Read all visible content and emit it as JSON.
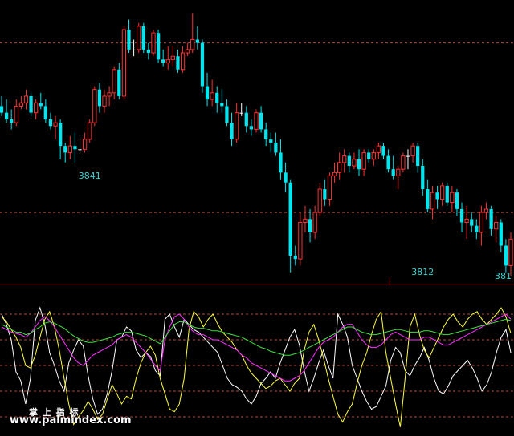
{
  "chart_data": [
    {
      "type": "candlestick",
      "title": "",
      "ylim": [
        3808,
        3890
      ],
      "colors": {
        "up": "#ff3030",
        "down": "#00e5ee",
        "doji": "#ffffff",
        "grid": "#b84a3a"
      },
      "grid_levels": [
        3879,
        3828
      ],
      "annotations": [
        {
          "label": "3841",
          "x": 18,
          "y": 3841
        },
        {
          "label": "3812",
          "x": 86,
          "y": 3812
        },
        {
          "label": "381",
          "x": 157,
          "y": 3811
        }
      ],
      "candles": [
        [
          3860,
          3863,
          3857,
          3858
        ],
        [
          3858,
          3862,
          3855,
          3856
        ],
        [
          3856,
          3859,
          3853,
          3855
        ],
        [
          3855,
          3862,
          3854,
          3860
        ],
        [
          3860,
          3863,
          3859,
          3861
        ],
        [
          3861,
          3865,
          3859,
          3863
        ],
        [
          3863,
          3864,
          3857,
          3858
        ],
        [
          3858,
          3862,
          3856,
          3861
        ],
        [
          3861,
          3864,
          3859,
          3860
        ],
        [
          3860,
          3862,
          3855,
          3856
        ],
        [
          3856,
          3858,
          3853,
          3854
        ],
        [
          3854,
          3857,
          3850,
          3855
        ],
        [
          3855,
          3856,
          3844,
          3848
        ],
        [
          3848,
          3849,
          3843,
          3846
        ],
        [
          3846,
          3851,
          3844,
          3848
        ],
        [
          3848,
          3852,
          3843,
          3847
        ],
        [
          3847,
          3850,
          3845,
          3847
        ],
        [
          3847,
          3852,
          3846,
          3850
        ],
        [
          3850,
          3856,
          3849,
          3855
        ],
        [
          3855,
          3866,
          3854,
          3865
        ],
        [
          3865,
          3867,
          3858,
          3860
        ],
        [
          3860,
          3865,
          3858,
          3863
        ],
        [
          3863,
          3866,
          3860,
          3864
        ],
        [
          3864,
          3872,
          3862,
          3871
        ],
        [
          3871,
          3873,
          3862,
          3863
        ],
        [
          3863,
          3884,
          3862,
          3883
        ],
        [
          3883,
          3886,
          3876,
          3877
        ],
        [
          3877,
          3880,
          3875,
          3877
        ],
        [
          3877,
          3885,
          3876,
          3884
        ],
        [
          3884,
          3885,
          3876,
          3877
        ],
        [
          3877,
          3879,
          3874,
          3876
        ],
        [
          3876,
          3883,
          3875,
          3882
        ],
        [
          3882,
          3883,
          3873,
          3874
        ],
        [
          3874,
          3877,
          3872,
          3873
        ],
        [
          3873,
          3878,
          3871,
          3874
        ],
        [
          3874,
          3878,
          3872,
          3875
        ],
        [
          3875,
          3877,
          3870,
          3871
        ],
        [
          3871,
          3878,
          3870,
          3876
        ],
        [
          3876,
          3879,
          3875,
          3877
        ],
        [
          3877,
          3888,
          3876,
          3880
        ],
        [
          3880,
          3884,
          3877,
          3879
        ],
        [
          3879,
          3880,
          3864,
          3866
        ],
        [
          3866,
          3870,
          3860,
          3862
        ],
        [
          3862,
          3868,
          3860,
          3864
        ],
        [
          3864,
          3866,
          3858,
          3861
        ],
        [
          3861,
          3865,
          3858,
          3860
        ],
        [
          3860,
          3862,
          3854,
          3855
        ],
        [
          3855,
          3858,
          3848,
          3850
        ],
        [
          3850,
          3861,
          3849,
          3858
        ],
        [
          3858,
          3861,
          3857,
          3858
        ],
        [
          3858,
          3860,
          3852,
          3854
        ],
        [
          3854,
          3856,
          3851,
          3853
        ],
        [
          3853,
          3859,
          3852,
          3858
        ],
        [
          3858,
          3860,
          3852,
          3853
        ],
        [
          3853,
          3855,
          3848,
          3850
        ],
        [
          3850,
          3852,
          3846,
          3849
        ],
        [
          3849,
          3852,
          3845,
          3846
        ],
        [
          3846,
          3850,
          3838,
          3840
        ],
        [
          3840,
          3843,
          3834,
          3837
        ],
        [
          3837,
          3838,
          3810,
          3815
        ],
        [
          3815,
          3818,
          3812,
          3814
        ],
        [
          3814,
          3828,
          3812,
          3825
        ],
        [
          3825,
          3830,
          3822,
          3826
        ],
        [
          3826,
          3829,
          3819,
          3822
        ],
        [
          3822,
          3830,
          3820,
          3828
        ],
        [
          3828,
          3837,
          3827,
          3835
        ],
        [
          3835,
          3838,
          3830,
          3832
        ],
        [
          3832,
          3840,
          3830,
          3839
        ],
        [
          3839,
          3843,
          3837,
          3840
        ],
        [
          3840,
          3846,
          3838,
          3843
        ],
        [
          3843,
          3847,
          3840,
          3845
        ],
        [
          3845,
          3846,
          3840,
          3842
        ],
        [
          3842,
          3846,
          3841,
          3844
        ],
        [
          3844,
          3847,
          3839,
          3841
        ],
        [
          3841,
          3847,
          3839,
          3846
        ],
        [
          3846,
          3847,
          3843,
          3844
        ],
        [
          3844,
          3847,
          3842,
          3846
        ],
        [
          3846,
          3849,
          3844,
          3848
        ],
        [
          3848,
          3849,
          3844,
          3845
        ],
        [
          3845,
          3847,
          3840,
          3841
        ],
        [
          3841,
          3845,
          3838,
          3839
        ],
        [
          3839,
          3842,
          3835,
          3841
        ],
        [
          3841,
          3846,
          3840,
          3845
        ],
        [
          3845,
          3847,
          3841,
          3845
        ],
        [
          3845,
          3849,
          3843,
          3848
        ],
        [
          3848,
          3849,
          3840,
          3842
        ],
        [
          3842,
          3844,
          3833,
          3835
        ],
        [
          3835,
          3838,
          3828,
          3829
        ],
        [
          3829,
          3836,
          3826,
          3834
        ],
        [
          3834,
          3836,
          3829,
          3832
        ],
        [
          3832,
          3837,
          3830,
          3836
        ],
        [
          3836,
          3837,
          3830,
          3831
        ],
        [
          3831,
          3836,
          3828,
          3834
        ],
        [
          3834,
          3835,
          3827,
          3829
        ],
        [
          3829,
          3831,
          3822,
          3825
        ],
        [
          3825,
          3830,
          3820,
          3826
        ],
        [
          3826,
          3828,
          3822,
          3824
        ],
        [
          3824,
          3826,
          3820,
          3822
        ],
        [
          3822,
          3830,
          3818,
          3828
        ],
        [
          3828,
          3831,
          3826,
          3829
        ],
        [
          3829,
          3830,
          3821,
          3823
        ],
        [
          3823,
          3827,
          3819,
          3825
        ],
        [
          3825,
          3826,
          3816,
          3818
        ],
        [
          3818,
          3820,
          3810,
          3812
        ],
        [
          3812,
          3822,
          3809,
          3820
        ]
      ]
    },
    {
      "type": "line",
      "title": "",
      "ylim": [
        0,
        100
      ],
      "grid_levels": [
        90,
        70,
        50,
        30,
        10
      ],
      "series": [
        {
          "color": "#ffffff",
          "values": [
            90,
            82,
            70,
            45,
            38,
            20,
            40,
            85,
            95,
            82,
            60,
            50,
            38,
            30,
            52,
            62,
            70,
            65,
            42,
            24,
            12,
            16,
            28,
            46,
            70,
            72,
            80,
            77,
            62,
            56,
            60,
            57,
            46,
            42,
            86,
            90,
            80,
            72,
            86,
            82,
            78,
            76,
            72,
            68,
            64,
            60,
            50,
            40,
            35,
            33,
            30,
            24,
            20,
            26,
            36,
            40,
            45,
            40,
            52,
            62,
            72,
            78,
            66,
            46,
            30,
            40,
            52,
            62,
            50,
            40,
            90,
            82,
            72,
            50,
            40,
            30,
            22,
            16,
            18,
            26,
            34,
            54,
            64,
            60,
            46,
            42,
            50,
            56,
            64,
            54,
            40,
            30,
            28,
            34,
            42,
            46,
            50,
            54,
            48,
            40,
            30,
            35,
            45,
            60,
            72,
            78,
            60
          ]
        },
        {
          "color": "#ffff40",
          "values": [
            88,
            84,
            78,
            72,
            64,
            50,
            48,
            58,
            72,
            86,
            92,
            80,
            62,
            40,
            20,
            4,
            10,
            15,
            22,
            16,
            8,
            12,
            24,
            35,
            28,
            20,
            26,
            24,
            40,
            52,
            60,
            65,
            58,
            40,
            28,
            16,
            14,
            20,
            40,
            78,
            92,
            88,
            80,
            86,
            90,
            82,
            76,
            72,
            68,
            62,
            58,
            50,
            44,
            40,
            36,
            32,
            34,
            38,
            40,
            35,
            30,
            36,
            40,
            62,
            76,
            82,
            70,
            56,
            40,
            26,
            12,
            6,
            14,
            20,
            36,
            50,
            60,
            74,
            86,
            92,
            60,
            40,
            20,
            2,
            40,
            80,
            90,
            74,
            62,
            56,
            64,
            72,
            80,
            86,
            90,
            84,
            80,
            86,
            90,
            92,
            86,
            82,
            86,
            90,
            95,
            88,
            75
          ]
        },
        {
          "color": "#ff30ff",
          "values": [
            80,
            78,
            76,
            75,
            74,
            72,
            75,
            80,
            85,
            88,
            85,
            80,
            74,
            68,
            62,
            56,
            52,
            50,
            54,
            58,
            60,
            62,
            64,
            66,
            70,
            72,
            74,
            72,
            68,
            64,
            60,
            55,
            50,
            46,
            70,
            80,
            88,
            90,
            86,
            80,
            76,
            74,
            74,
            72,
            70,
            70,
            68,
            66,
            64,
            62,
            58,
            56,
            52,
            50,
            48,
            46,
            44,
            42,
            40,
            38,
            38,
            40,
            42,
            46,
            52,
            58,
            64,
            68,
            70,
            72,
            76,
            80,
            82,
            82,
            76,
            70,
            66,
            64,
            64,
            66,
            70,
            74,
            76,
            74,
            72,
            70,
            70,
            70,
            72,
            72,
            70,
            68,
            66,
            66,
            68,
            70,
            72,
            74,
            76,
            78,
            80,
            82,
            84,
            86,
            88,
            90,
            86
          ]
        },
        {
          "color": "#40e040",
          "values": [
            82,
            80,
            78,
            76,
            76,
            74,
            75,
            78,
            80,
            83,
            84,
            83,
            81,
            79,
            76,
            73,
            71,
            69,
            68,
            68,
            69,
            70,
            71,
            72,
            74,
            75,
            76,
            76,
            75,
            74,
            73,
            71,
            69,
            67,
            72,
            77,
            82,
            84,
            84,
            82,
            80,
            79,
            79,
            78,
            77,
            77,
            76,
            75,
            74,
            73,
            72,
            70,
            68,
            66,
            64,
            63,
            61,
            60,
            59,
            58,
            58,
            59,
            60,
            62,
            64,
            66,
            68,
            70,
            72,
            74,
            76,
            78,
            80,
            80,
            78,
            76,
            75,
            74,
            74,
            75,
            76,
            77,
            78,
            78,
            77,
            76,
            76,
            76,
            77,
            77,
            76,
            75,
            74,
            74,
            75,
            76,
            77,
            78,
            79,
            80,
            81,
            82,
            83,
            84,
            85,
            86,
            85
          ]
        }
      ]
    }
  ],
  "watermark": {
    "cn": "掌 上 指 标",
    "url": "www.palmindex.com"
  }
}
